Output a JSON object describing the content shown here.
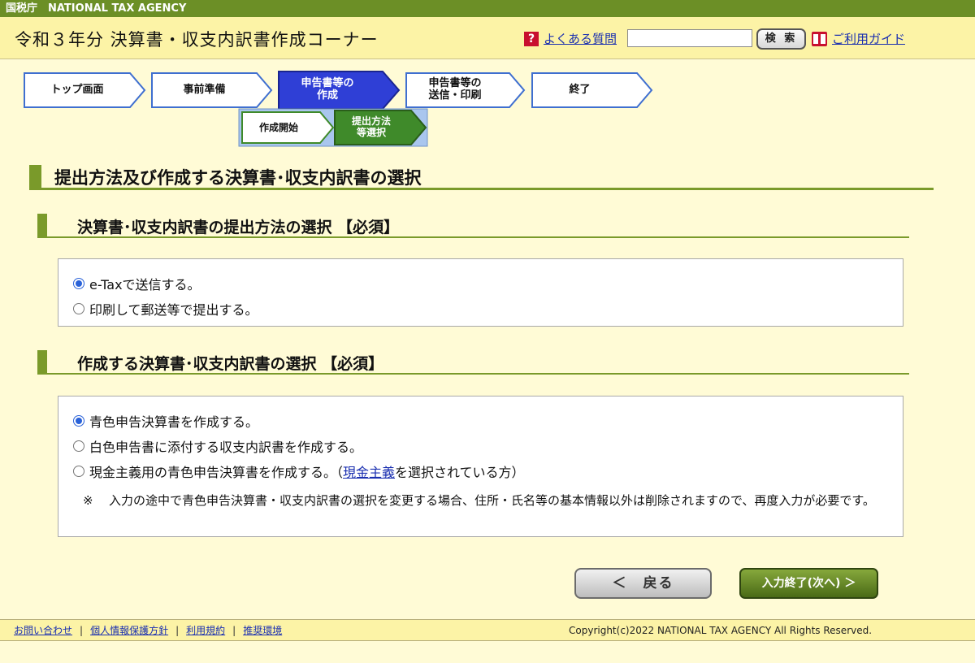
{
  "agency_bar": {
    "text": "国税庁　NATIONAL TAX AGENCY"
  },
  "header": {
    "title": "令和３年分 決算書・収支内訳書作成コーナー",
    "faq_icon": "?",
    "faq_link": "よくある質問",
    "search_value": "",
    "search_button": "検 索",
    "guide_link": "ご利用ガイド"
  },
  "steps": {
    "main": [
      {
        "label": "トップ画面",
        "state": "done"
      },
      {
        "label": "事前準備",
        "state": "done"
      },
      {
        "label_line1": "申告書等の",
        "label_line2": "作成",
        "state": "current"
      },
      {
        "label_line1": "申告書等の",
        "label_line2": "送信・印刷",
        "state": "todo"
      },
      {
        "label": "終了",
        "state": "todo"
      }
    ],
    "sub": [
      {
        "label": "作成開始",
        "state": "done"
      },
      {
        "label_line1": "提出方法",
        "label_line2": "等選択",
        "state": "current"
      }
    ]
  },
  "main": {
    "heading": "提出方法及び作成する決算書･収支内訳書の選択",
    "submission": {
      "heading": "決算書･収支内訳書の提出方法の選択 【必須】",
      "options": [
        {
          "label": "e-Taxで送信する。",
          "checked": true
        },
        {
          "label": "印刷して郵送等で提出する。",
          "checked": false
        }
      ]
    },
    "document": {
      "heading": "作成する決算書･収支内訳書の選択 【必須】",
      "options": [
        {
          "label": "青色申告決算書を作成する。",
          "checked": true
        },
        {
          "label": "白色申告書に添付する収支内訳書を作成する。",
          "checked": false
        },
        {
          "label_before": "現金主義用の青色申告決算書を作成する。（",
          "label_link": "現金主義",
          "label_after": "を選択されている方）",
          "checked": false
        }
      ],
      "note_mark": "※",
      "note": "入力の途中で青色申告決算書・収支内訳書の選択を変更する場合、住所・氏名等の基本情報以外は削除されますので、再度入力が必要です。"
    }
  },
  "buttons": {
    "back": "＜　戻る",
    "next": "入力終了(次へ) ＞"
  },
  "footer": {
    "links": [
      "お問い合わせ",
      "個人情報保護方針",
      "利用規約",
      "推奨環境"
    ],
    "separator": "|",
    "copyright": "Copyright(c)2022 NATIONAL TAX AGENCY All Rights Reserved."
  },
  "colors": {
    "agency_bar": "#6c8f26",
    "header_bg": "#fcf3a6",
    "page_bg": "#fffbd6",
    "accent_green": "#7a9a2a",
    "current_step": "#2f3fd6",
    "current_sub_step": "#3f8a2a",
    "link": "#1a2fb0"
  }
}
